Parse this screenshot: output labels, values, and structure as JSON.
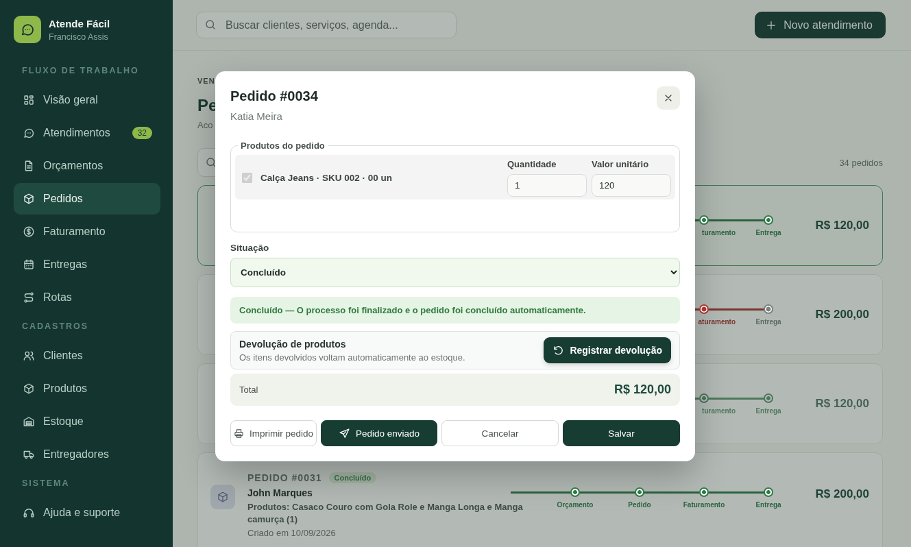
{
  "sidebar": {
    "brand": {
      "name": "Atende Fácil",
      "user": "Francisco Assis"
    },
    "sections": [
      {
        "title": "FLUXO DE TRABALHO",
        "items": [
          {
            "label": "Visão geral",
            "selected": false
          },
          {
            "label": "Atendimentos",
            "badge": "32",
            "selected": false
          },
          {
            "label": "Orçamentos",
            "selected": false
          },
          {
            "label": "Pedidos",
            "selected": true
          },
          {
            "label": "Faturamento",
            "selected": false
          },
          {
            "label": "Entregas",
            "selected": false
          },
          {
            "label": "Rotas",
            "selected": false
          }
        ]
      },
      {
        "title": "CADASTROS",
        "items": [
          {
            "label": "Clientes",
            "selected": false
          },
          {
            "label": "Produtos",
            "selected": false
          },
          {
            "label": "Estoque",
            "selected": false
          },
          {
            "label": "Entregadores",
            "selected": false
          }
        ]
      },
      {
        "title": "SISTEMA",
        "items": [
          {
            "label": "Ajuda e suporte",
            "selected": false
          }
        ]
      }
    ]
  },
  "topbar": {
    "search": {
      "placeholder": "Buscar clientes, serviços, agenda..."
    },
    "new_button": "Novo atendimento"
  },
  "page": {
    "eyebrow": "VEN",
    "title": "Pe",
    "subtitle": "Aco",
    "count": "34 pedidos"
  },
  "orders": [
    {
      "selected": true,
      "muted": false,
      "price": "R$ 120,00",
      "steps": [
        {
          "label": "turamento",
          "done": true,
          "error": false
        },
        {
          "label": "Entrega",
          "done": true,
          "error": false
        }
      ]
    },
    {
      "selected": false,
      "muted": false,
      "price": "R$ 200,00",
      "steps": [
        {
          "label": "aturamento",
          "done": false,
          "error": true
        },
        {
          "label": "Entrega",
          "done": false,
          "error": false
        }
      ]
    },
    {
      "selected": false,
      "muted": true,
      "price": "R$ 120,00",
      "steps": [
        {
          "label": "turamento",
          "done": true,
          "error": false
        },
        {
          "label": "Entrega",
          "done": true,
          "error": false
        }
      ]
    },
    {
      "selected": false,
      "muted": false,
      "number": "PEDIDO #0031",
      "status": "Concluído",
      "customer": "John Marques",
      "products": "Produtos: Casaco Couro com Gola Role e Manga Longa e Manga camurça (1)",
      "created": "Criado em 10/09/2026",
      "price": "R$ 200,00",
      "steps": [
        {
          "label": "Orçamento",
          "done": true,
          "error": false
        },
        {
          "label": "Pedido",
          "done": true,
          "error": false
        },
        {
          "label": "Faturamento",
          "done": true,
          "error": false
        },
        {
          "label": "Entrega",
          "done": true,
          "error": false
        }
      ]
    }
  ],
  "modal": {
    "title": "Pedido #0034",
    "subtitle": "Katia Meira",
    "products": {
      "legend": "Produtos do pedido",
      "items": [
        {
          "label": "Calça Jeans · SKU 002 · 00 un",
          "checked": true,
          "disabled": true,
          "quantity_label": "Quantidade",
          "quantity": "1",
          "price_label": "Valor unitário",
          "price": "120"
        }
      ]
    },
    "status_label": "Situação",
    "status": "Concluído",
    "notice": "Concluído — O processo foi finalizado e o pedido foi concluído automaticamente.",
    "returns": {
      "title": "Devolução de produtos",
      "description": "Os itens devolvidos voltam automaticamente ao estoque.",
      "button": "Registrar devolução"
    },
    "total_label": "Total",
    "total": "R$ 120,00",
    "buttons": [
      {
        "label": "Imprimir pedido",
        "kind": "print"
      },
      {
        "label": "Pedido enviado",
        "kind": "send"
      },
      {
        "label": "Cancelar",
        "kind": "cancel"
      },
      {
        "label": "Salvar",
        "kind": "save"
      }
    ]
  }
}
